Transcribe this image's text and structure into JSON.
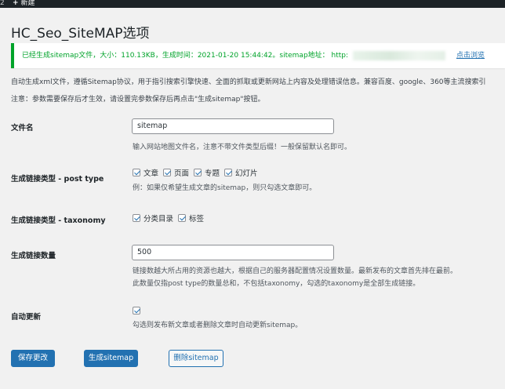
{
  "adminbar": {
    "left_text": "2",
    "new_label": "新建"
  },
  "page": {
    "title": "HC_Seo_SiteMAP选项"
  },
  "notice": {
    "text": "已经生成sitemap文件，大小：110.13KB，生成时间：2021-01-20 15:44:42。sitemap地址： http:",
    "link_label": "点击浏览",
    "accent_color": "#00a32a"
  },
  "description": {
    "line1": "自动生成xml文件，遵循Sitemap协议，用于指引搜索引擎快速、全面的抓取或更新网站上内容及处理错误信息。兼容百度、google、360等主流搜索引",
    "line2": "注意：参数需要保存后才生效，请设置完参数保存后再点击\"生成sitemap\"按钮。"
  },
  "fields": {
    "filename": {
      "label": "文件名",
      "value": "sitemap",
      "hint": "输入网站地图文件名，注意不带文件类型后缀！一般保留默认名即可。"
    },
    "post_type": {
      "label": "生成链接类型 - post type",
      "options": [
        {
          "label": "文章",
          "checked": true
        },
        {
          "label": "页面",
          "checked": true
        },
        {
          "label": "专题",
          "checked": true
        },
        {
          "label": "幻灯片",
          "checked": true
        }
      ],
      "hint": "例：如果仅希望生成文章的sitemap，则只勾选文章即可。"
    },
    "taxonomy": {
      "label": "生成链接类型 - taxonomy",
      "options": [
        {
          "label": "分类目录",
          "checked": true
        },
        {
          "label": "标签",
          "checked": true
        }
      ]
    },
    "count": {
      "label": "生成链接数量",
      "value": "500",
      "hint1": "链接数越大所占用的资源也越大，根据自己的服务器配置情况设置数量。最新发布的文章首先排在最前。",
      "hint2": "此数量仅指post type的数量总和，不包括taxonomy，勾选的taxonomy是全部生成链接。"
    },
    "auto_update": {
      "label": "自动更新",
      "checked": true,
      "hint": "勾选则发布新文章或者删除文章时自动更新sitemap。"
    }
  },
  "buttons": {
    "save": "保存更改",
    "generate": "生成sitemap",
    "delete": "删除sitemap"
  },
  "colors": {
    "primary": "#2271b1",
    "success": "#00a32a"
  }
}
